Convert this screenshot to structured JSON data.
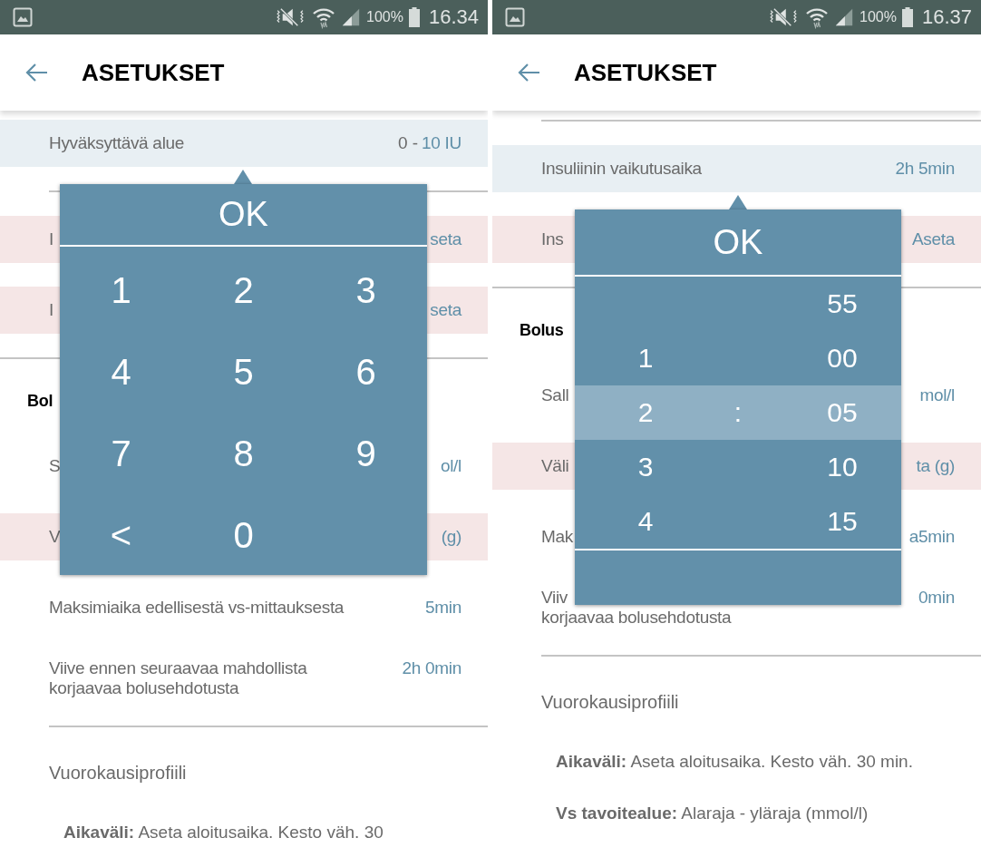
{
  "screens": [
    {
      "status_bar": {
        "battery": "100%",
        "time": "16.34"
      },
      "app_bar": {
        "title": "ASETUKSET"
      },
      "items": [
        {
          "kind": "setting",
          "selected": true,
          "warning": false,
          "label": "Hyväksyttävä alue",
          "value_prefix": "0 -",
          "value": "10 IU",
          "popup": {
            "kind": "keypad",
            "ok": "OK",
            "keys": [
              "1",
              "2",
              "3",
              "4",
              "5",
              "6",
              "7",
              "8",
              "9",
              "<",
              "0"
            ]
          }
        },
        {
          "kind": "divider",
          "inset": true
        },
        {
          "kind": "setting",
          "selected": false,
          "warning": true,
          "label": "I",
          "value": "seta"
        },
        {
          "kind": "setting",
          "selected": false,
          "warning": true,
          "label": "I",
          "value": "seta"
        },
        {
          "kind": "divider",
          "inset": false
        },
        {
          "kind": "header",
          "label": "Bol"
        },
        {
          "kind": "setting",
          "selected": false,
          "warning": false,
          "label": "S",
          "value": "ol/l"
        },
        {
          "kind": "setting",
          "selected": false,
          "warning": true,
          "label": "V",
          "value": "(g)"
        },
        {
          "kind": "setting",
          "selected": false,
          "warning": false,
          "label": "Maksimiaika edellisestä vs-mittauksesta",
          "value": "5min"
        },
        {
          "kind": "setting",
          "selected": false,
          "warning": false,
          "label": "Viive ennen seuraavaa mahdollista",
          "label_line2": "korjaavaa bolusehdotusta",
          "value": "2h 0min"
        },
        {
          "kind": "divider",
          "inset": true
        },
        {
          "kind": "title",
          "label": "Vuorokausiprofiili"
        },
        {
          "kind": "note",
          "text": "**Aikaväli:** Aseta aloitusaika. Kesto väh. 30"
        }
      ]
    },
    {
      "status_bar": {
        "battery": "100%",
        "time": "16.37"
      },
      "app_bar": {
        "title": "ASETUKSET"
      },
      "items": [
        {
          "kind": "divider",
          "inset": true
        },
        {
          "kind": "setting",
          "selected": true,
          "warning": false,
          "label": "Insuliinin vaikutusaika",
          "value": "2h 5min",
          "popup": {
            "kind": "time_picker",
            "ok": "OK",
            "rows": [
              {
                "minutes": "55",
                "selected": false
              },
              {
                "hours": "1",
                "minutes": "00",
                "selected": false
              },
              {
                "hours": "2",
                "separator": ":",
                "minutes": "05",
                "selected": true
              },
              {
                "hours": "3",
                "minutes": "10",
                "selected": false
              },
              {
                "hours": "4",
                "minutes": "15",
                "selected": false
              }
            ]
          }
        },
        {
          "kind": "setting",
          "selected": false,
          "warning": true,
          "label": "Ins",
          "value": "Aseta"
        },
        {
          "kind": "divider",
          "inset": false
        },
        {
          "kind": "header",
          "label": "Bolus"
        },
        {
          "kind": "setting",
          "selected": false,
          "warning": false,
          "label": "Sall",
          "value": "mol/l"
        },
        {
          "kind": "setting",
          "selected": false,
          "warning": true,
          "label": "Väli",
          "value": "ta (g)"
        },
        {
          "kind": "setting",
          "selected": false,
          "warning": false,
          "label": "Mak",
          "value": "a5min"
        },
        {
          "kind": "setting",
          "selected": false,
          "warning": false,
          "label": "Viiv",
          "label_line2": "korjaavaa bolusehdotusta",
          "value": "0min"
        },
        {
          "kind": "divider",
          "inset": true
        },
        {
          "kind": "title",
          "label": "Vuorokausiprofiili"
        },
        {
          "kind": "note",
          "text": "**Aikaväli:** Aseta aloitusaika. Kesto väh. 30 min."
        },
        {
          "kind": "note",
          "text": "**Vs tavoitealue:** Alaraja - yläraja (mmol/l)"
        }
      ]
    }
  ]
}
